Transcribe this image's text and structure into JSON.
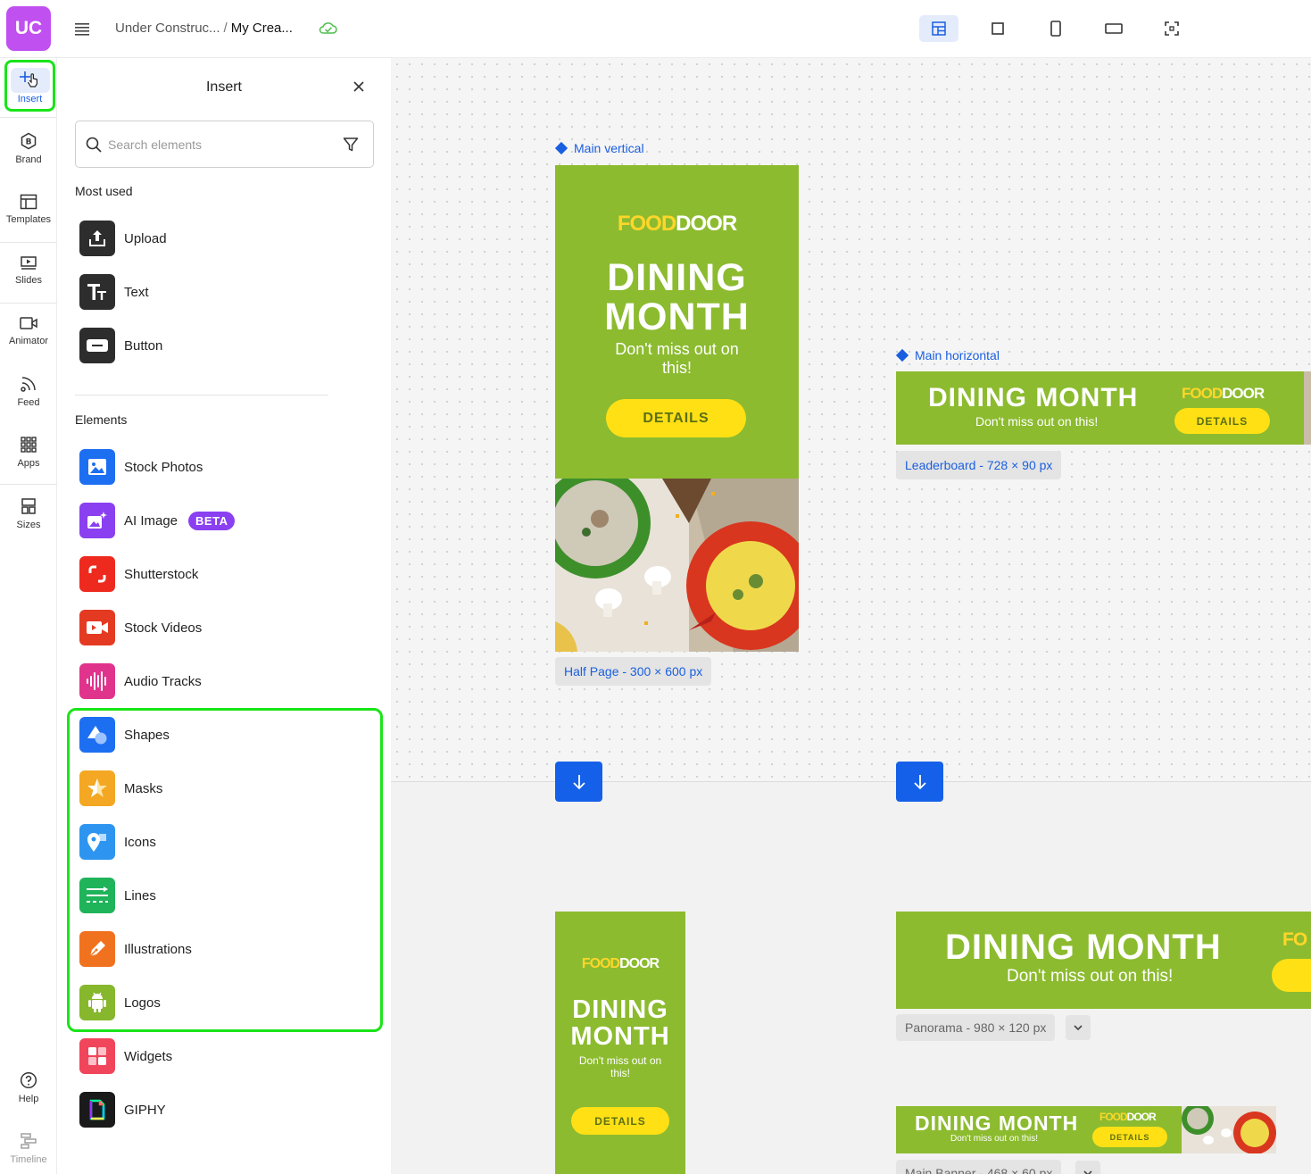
{
  "header": {
    "logo_text": "UC",
    "breadcrumb_parent": "Under Construc...",
    "breadcrumb_separator": "/",
    "breadcrumb_current": "My Crea..."
  },
  "rail": {
    "items": [
      {
        "label": "Insert",
        "icon": "plus-icon"
      },
      {
        "label": "Brand",
        "icon": "brand-icon"
      },
      {
        "label": "Templates",
        "icon": "templates-icon"
      },
      {
        "label": "Slides",
        "icon": "slides-icon"
      },
      {
        "label": "Animator",
        "icon": "animator-icon"
      },
      {
        "label": "Feed",
        "icon": "feed-icon"
      },
      {
        "label": "Apps",
        "icon": "apps-icon"
      },
      {
        "label": "Sizes",
        "icon": "sizes-icon"
      }
    ],
    "help_label": "Help",
    "timeline_label": "Timeline"
  },
  "panel": {
    "title": "Insert",
    "search_placeholder": "Search elements",
    "most_used_label": "Most used",
    "most_used": [
      {
        "label": "Upload",
        "icon": "upload-icon",
        "color": "#2d2d2d"
      },
      {
        "label": "Text",
        "icon": "text-icon",
        "color": "#2d2d2d"
      },
      {
        "label": "Button",
        "icon": "button-icon",
        "color": "#2d2d2d"
      }
    ],
    "elements_label": "Elements",
    "elements": [
      {
        "label": "Stock Photos",
        "icon": "image-icon",
        "color": "#1d6ff2"
      },
      {
        "label": "AI Image",
        "icon": "ai-image-icon",
        "color": "#8a40f0",
        "badge": "BETA"
      },
      {
        "label": "Shutterstock",
        "icon": "shutterstock-icon",
        "color": "#ee2a1f"
      },
      {
        "label": "Stock Videos",
        "icon": "video-icon",
        "color": "#e53a22"
      },
      {
        "label": "Audio Tracks",
        "icon": "audio-icon",
        "color": "#e0338c"
      },
      {
        "label": "Shapes",
        "icon": "shapes-icon",
        "color": "#1d6ff2"
      },
      {
        "label": "Masks",
        "icon": "star-mask-icon",
        "color": "#f3a722"
      },
      {
        "label": "Icons",
        "icon": "map-pin-icon",
        "color": "#2d95f0"
      },
      {
        "label": "Lines",
        "icon": "lines-icon",
        "color": "#1fb35a"
      },
      {
        "label": "Illustrations",
        "icon": "pen-icon",
        "color": "#f0721e"
      },
      {
        "label": "Logos",
        "icon": "android-icon",
        "color": "#86b72c"
      },
      {
        "label": "Widgets",
        "icon": "widgets-icon",
        "color": "#f0455a"
      },
      {
        "label": "GIPHY",
        "icon": "giphy-icon",
        "color": "#1a1a1a"
      }
    ]
  },
  "canvas": {
    "main_vertical_label": "Main vertical",
    "main_horizontal_label": "Main horizontal",
    "half_page_tag": "Half Page - 300 × 600 px",
    "leaderboard_tag": "Leaderboard - 728 × 90 px",
    "panorama_tag": "Panorama - 980 × 120 px",
    "main_banner_tag": "Main Banner - 468 × 60 px",
    "ad": {
      "brand_a": "FOOD",
      "brand_b": "DOOR",
      "headline": "DINING MONTH",
      "headline_line1": "DINING",
      "headline_line2": "MONTH",
      "subline": "Don't miss out on this!",
      "cta": "DETAILS",
      "brand_partial": "FO"
    },
    "accent_color": "#1560e8",
    "ad_green": "#8cbb2f",
    "ad_yellow": "#ffe015"
  }
}
